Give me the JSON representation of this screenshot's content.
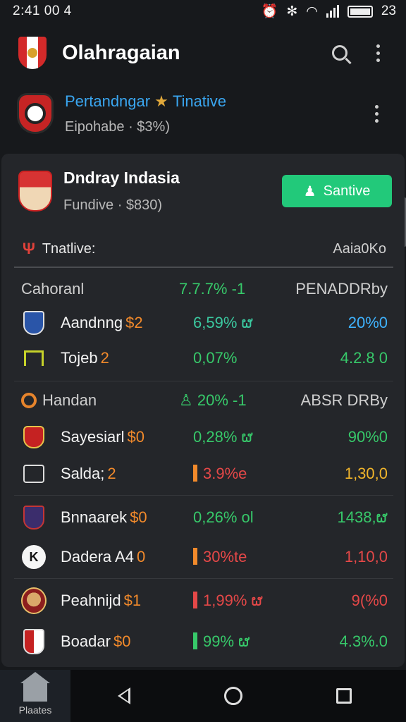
{
  "status": {
    "time": "2:41 00 4",
    "battery": "23"
  },
  "appbar": {
    "title": "Olahragaian"
  },
  "match": {
    "title": "Pertandngar",
    "tag": "Tinative",
    "subtitle": "Eipohabe · $3%)"
  },
  "featured": {
    "name": "Dndray Indasia",
    "subtitle": "Fundive · $830)",
    "cta_label": "Santive"
  },
  "filter": {
    "label": "Tnatlive:",
    "value": "Aaia0Ko"
  },
  "sections": [
    {
      "header": {
        "name": "Cahoranl",
        "pct": "7.7.7% -1",
        "value": "PENADDRby"
      },
      "rows": [
        {
          "name": "Aandnng",
          "amount": "$2",
          "pct": "6,59% ຜ",
          "value": "20%0"
        },
        {
          "name": "Tojeb",
          "amount": "2",
          "pct": "0,07%",
          "value": "4.2.8 0"
        }
      ]
    },
    {
      "header": {
        "name": "Handan",
        "pct": "20% -1",
        "value": "ABSR DRBy"
      },
      "rows": [
        {
          "name": "Sayesiarl",
          "amount": "$0",
          "pct": "0,28% ຜ",
          "value": "90%0"
        },
        {
          "name": "Salda;",
          "amount": "2",
          "pct": "3.9%e",
          "value": "1,30,0"
        }
      ]
    },
    {
      "rows": [
        {
          "name": "Bnnaarek",
          "amount": "$0",
          "pct": "0,26% ol",
          "value": "1438,ຜ"
        },
        {
          "name": "Dadera A4",
          "amount": "0",
          "pct": "30%te",
          "value": "1,10,0",
          "badge": "K"
        }
      ]
    },
    {
      "rows": [
        {
          "name": "Peahnijd",
          "amount": "$1",
          "pct": "1,99% ຜ",
          "value": "9(%0"
        },
        {
          "name": "Boadar",
          "amount": "$0",
          "pct": "99% ຜ",
          "value": "4.3%.0"
        }
      ]
    }
  ],
  "nav": {
    "home_label": "Plaates"
  },
  "colors": {
    "accent": "#22c97a",
    "positive": "#37c96a",
    "negative": "#e54848",
    "warning": "#f1b52b",
    "link": "#3aa6f0"
  }
}
